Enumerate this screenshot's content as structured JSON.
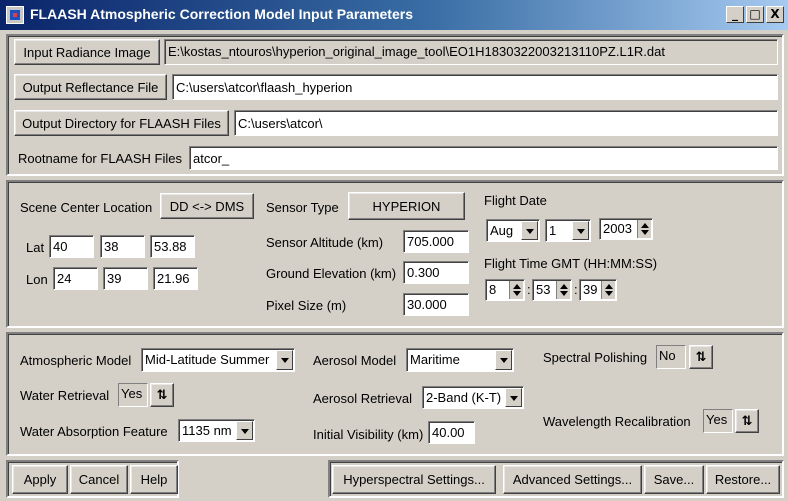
{
  "window": {
    "title": "FLAASH Atmospheric Correction Model Input Parameters",
    "minimize": "_",
    "maximize": "□",
    "close": "X"
  },
  "files": {
    "input_radiance_label": "Input Radiance Image",
    "input_radiance_value": "E:\\kostas_ntouros\\hyperion_original_image_tool\\EO1H1830322003213110PZ.L1R.dat",
    "output_reflectance_label": "Output Reflectance File",
    "output_reflectance_value": "C:\\users\\atcor\\flaash_hyperion",
    "output_directory_label": "Output Directory for FLAASH Files",
    "output_directory_value": "C:\\users\\atcor\\",
    "rootname_label": "Rootname for FLAASH Files",
    "rootname_value": "atcor_"
  },
  "scene": {
    "center_location_label": "Scene Center Location",
    "dd_dms_button": "DD <-> DMS",
    "lat_label": "Lat",
    "lat_deg": "40",
    "lat_min": "38",
    "lat_sec": "53.88",
    "lon_label": "Lon",
    "lon_deg": "24",
    "lon_min": "39",
    "lon_sec": "21.96",
    "sensor_type_label": "Sensor Type",
    "sensor_type_button": "HYPERION",
    "sensor_altitude_label": "Sensor Altitude (km)",
    "sensor_altitude_value": "705.000",
    "ground_elevation_label": "Ground Elevation (km)",
    "ground_elevation_value": "0.300",
    "pixel_size_label": "Pixel Size (m)",
    "pixel_size_value": "30.000",
    "flight_date_label": "Flight Date",
    "flight_month": "Aug",
    "flight_day": "1",
    "flight_year": "2003",
    "flight_time_label": "Flight Time GMT (HH:MM:SS)",
    "flight_hour": "8",
    "flight_minute": "53",
    "flight_second": "39",
    "colon": ":"
  },
  "model": {
    "atmospheric_model_label": "Atmospheric Model",
    "atmospheric_model_value": "Mid-Latitude Summer",
    "water_retrieval_label": "Water Retrieval",
    "water_retrieval_value": "Yes",
    "water_absorption_label": "Water Absorption Feature",
    "water_absorption_value": "1135 nm",
    "aerosol_model_label": "Aerosol Model",
    "aerosol_model_value": "Maritime",
    "aerosol_retrieval_label": "Aerosol Retrieval",
    "aerosol_retrieval_value": "2-Band (K-T)",
    "initial_visibility_label": "Initial Visibility (km)",
    "initial_visibility_value": "40.00",
    "spectral_polishing_label": "Spectral Polishing",
    "spectral_polishing_value": "No",
    "wavelength_recal_label": "Wavelength Recalibration",
    "wavelength_recal_value": "Yes",
    "toggle_glyph": "⇅"
  },
  "footer": {
    "apply": "Apply",
    "cancel": "Cancel",
    "help": "Help",
    "hyperspectral": "Hyperspectral Settings...",
    "advanced": "Advanced Settings...",
    "save": "Save...",
    "restore": "Restore..."
  }
}
